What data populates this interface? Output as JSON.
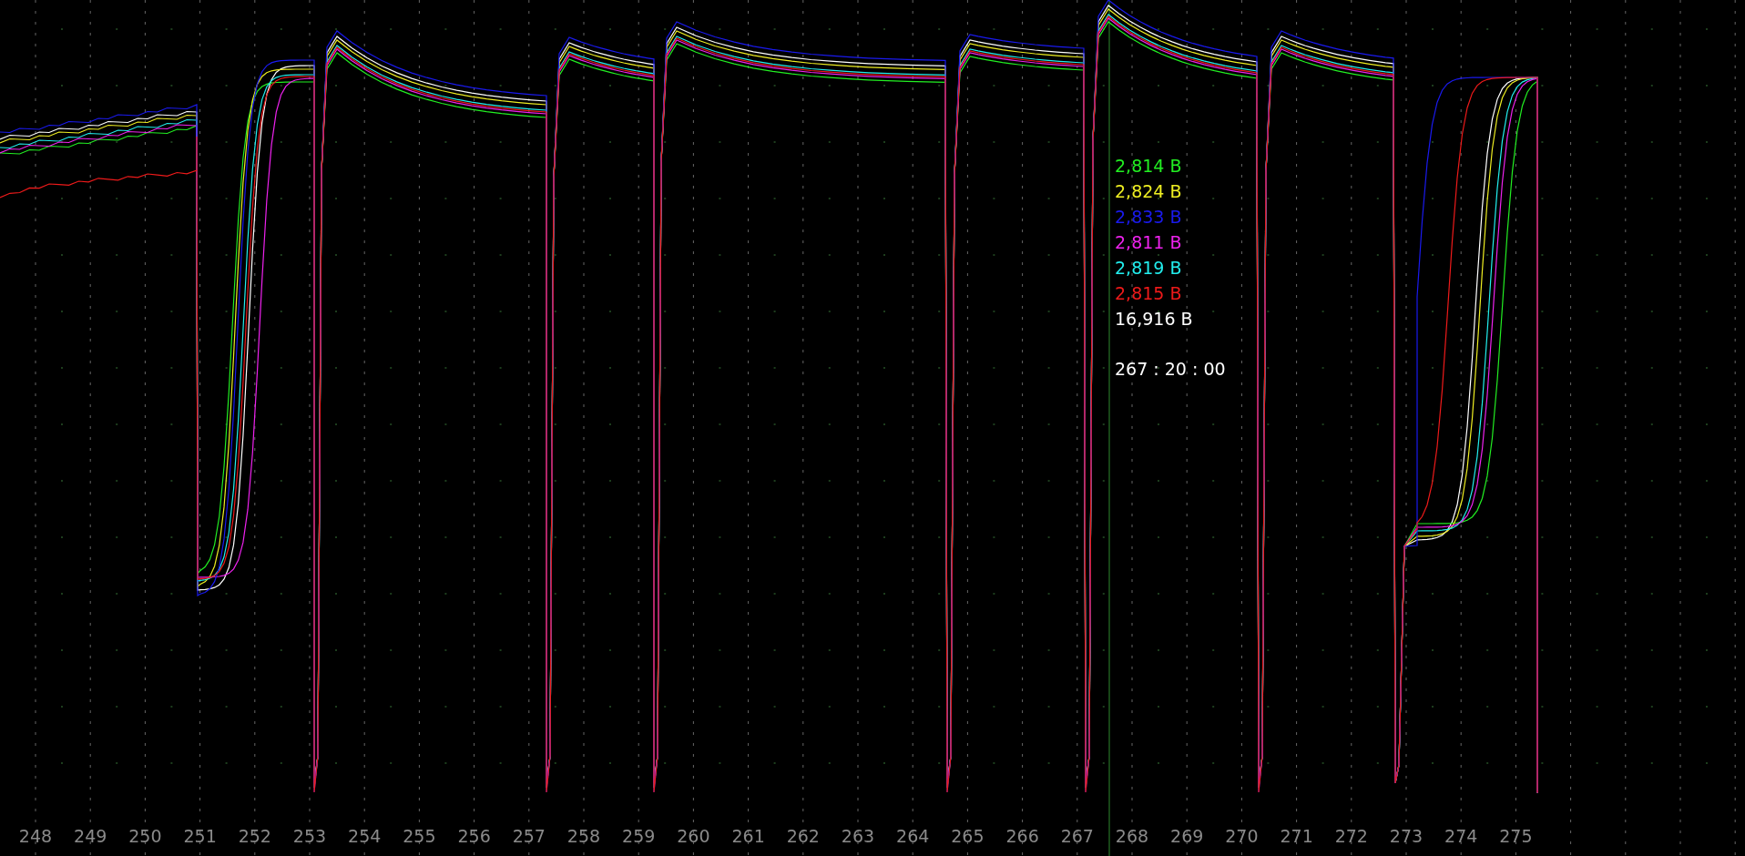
{
  "x_axis_labels": [
    "248",
    "249",
    "250",
    "251",
    "252",
    "253",
    "254",
    "255",
    "256",
    "257",
    "258",
    "259",
    "260",
    "261",
    "262",
    "263",
    "264",
    "265",
    "266",
    "267",
    "268",
    "269",
    "270",
    "271",
    "272",
    "273",
    "274",
    "275"
  ],
  "cursor_readout": {
    "values": [
      {
        "text": "2,814 B",
        "color": "#22ee22"
      },
      {
        "text": "2,824 B",
        "color": "#eeee22"
      },
      {
        "text": "2,833 B",
        "color": "#1a1aee"
      },
      {
        "text": "2,811 B",
        "color": "#ee22ee"
      },
      {
        "text": "2,819 B",
        "color": "#22eeee"
      },
      {
        "text": "2,815 B",
        "color": "#ee1a1a"
      },
      {
        "text": "16,916 B",
        "color": "#ffffff"
      }
    ],
    "time": "267 : 20 : 00"
  }
}
